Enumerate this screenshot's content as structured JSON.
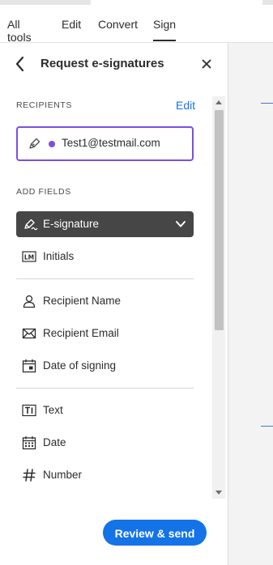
{
  "tabs": [
    {
      "label": "All tools"
    },
    {
      "label": "Edit"
    },
    {
      "label": "Convert"
    },
    {
      "label": "Sign",
      "active": true
    }
  ],
  "panel": {
    "title": "Request e-signatures",
    "back_icon": "chevron-left-icon",
    "close_icon": "close-icon"
  },
  "recipients": {
    "section_label": "RECIPIENTS",
    "edit_label": "Edit",
    "items": [
      {
        "email": "Test1@testmail.com",
        "color": "#7b4fe0",
        "icon": "pen-icon"
      }
    ]
  },
  "add_fields": {
    "section_label": "ADD FIELDS",
    "selected": {
      "label": "E-signature",
      "icon": "signature-pen-icon"
    },
    "groups": [
      [
        {
          "label": "Initials",
          "icon": "initials-icon"
        }
      ],
      [
        {
          "label": "Recipient Name",
          "icon": "person-icon"
        },
        {
          "label": "Recipient Email",
          "icon": "envelope-icon"
        },
        {
          "label": "Date of signing",
          "icon": "calendar-signing-icon"
        }
      ],
      [
        {
          "label": "Text",
          "icon": "text-field-icon"
        },
        {
          "label": "Date",
          "icon": "calendar-icon"
        },
        {
          "label": "Number",
          "icon": "hash-icon"
        }
      ]
    ]
  },
  "actions": {
    "review_label": "Review & send"
  },
  "colors": {
    "accent": "#1473e6",
    "recipient": "#7b4fe0",
    "selected_field_bg": "#464646"
  }
}
